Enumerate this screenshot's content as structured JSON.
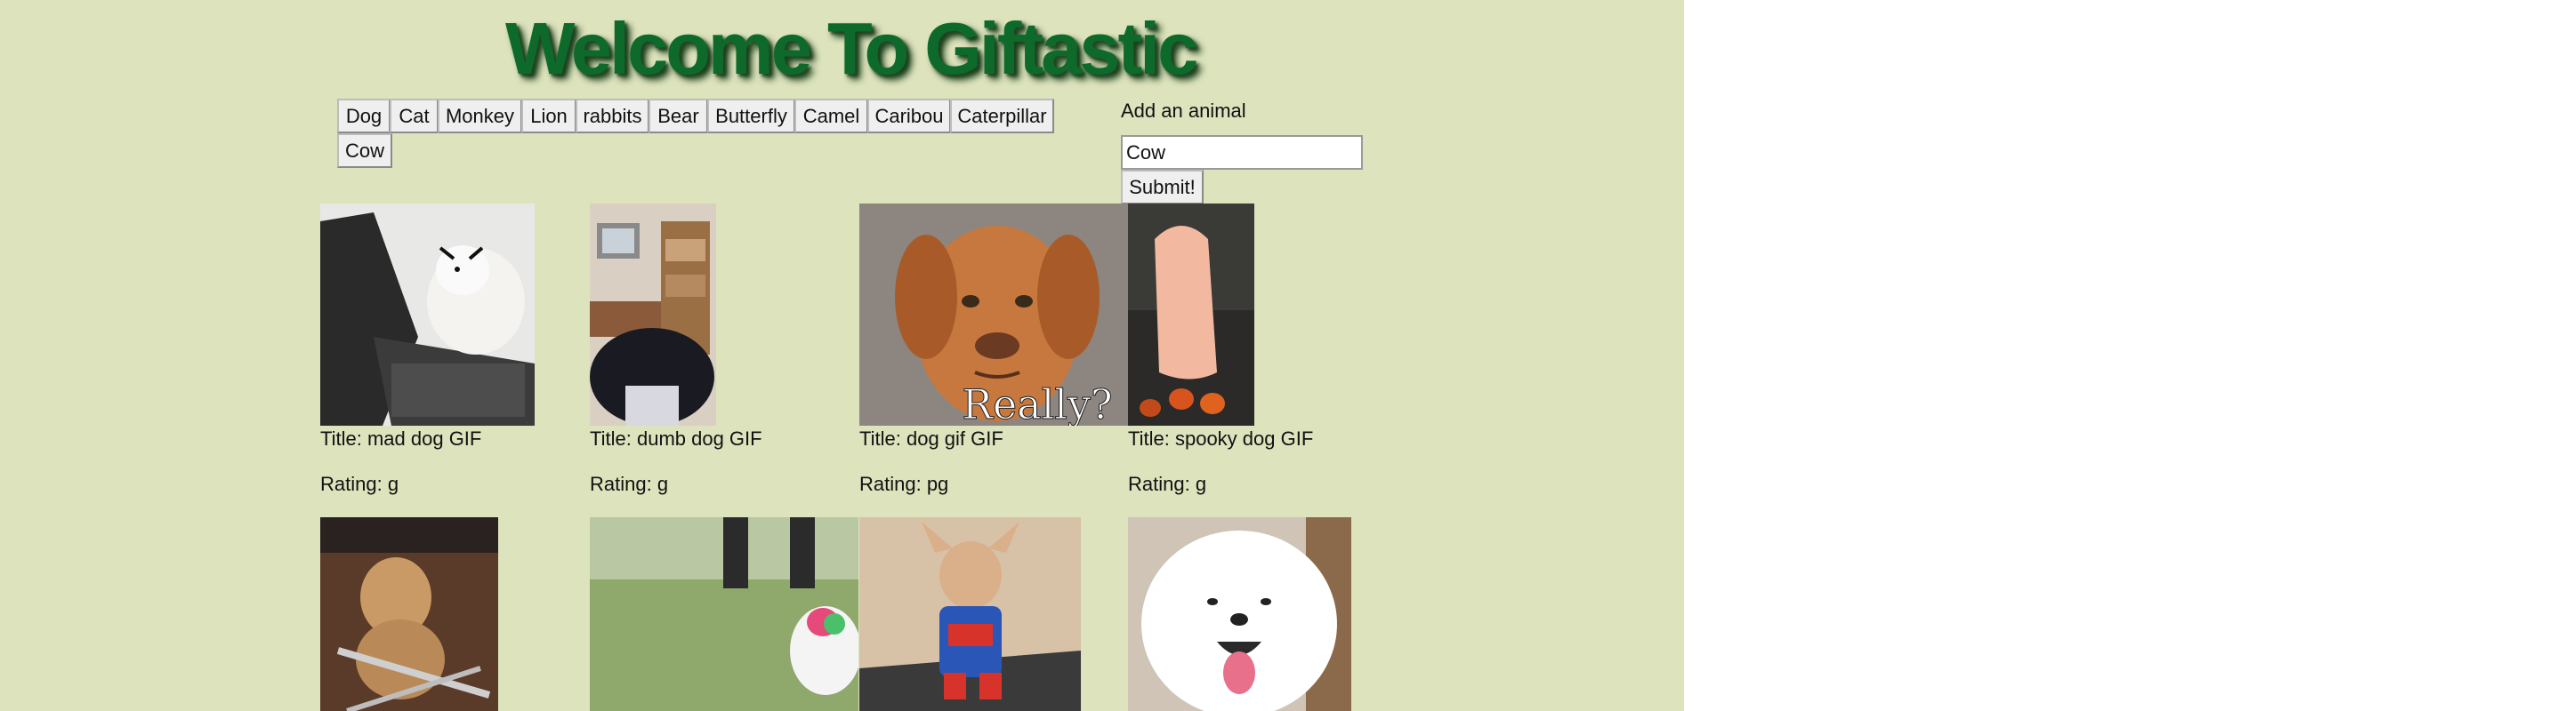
{
  "header": {
    "title": "Welcome To Giftastic"
  },
  "topic_buttons": [
    "Dog",
    "Cat",
    "Monkey",
    "Lion",
    "rabbits",
    "Bear",
    "Butterfly",
    "Camel",
    "Caribou",
    "Caterpillar",
    "Cow"
  ],
  "add_form": {
    "label": "Add an animal",
    "input_value": "Cow",
    "submit_label": "Submit!"
  },
  "gifs": [
    {
      "title": "Title: mad dog GIF",
      "rating": "Rating: g"
    },
    {
      "title": "Title: dumb dog GIF",
      "rating": "Rating: g"
    },
    {
      "title": "Title: dog gif GIF",
      "rating": "Rating: pg",
      "caption": "Really?"
    },
    {
      "title": "Title: spooky dog GIF",
      "rating": "Rating: g"
    },
    {},
    {},
    {},
    {}
  ]
}
